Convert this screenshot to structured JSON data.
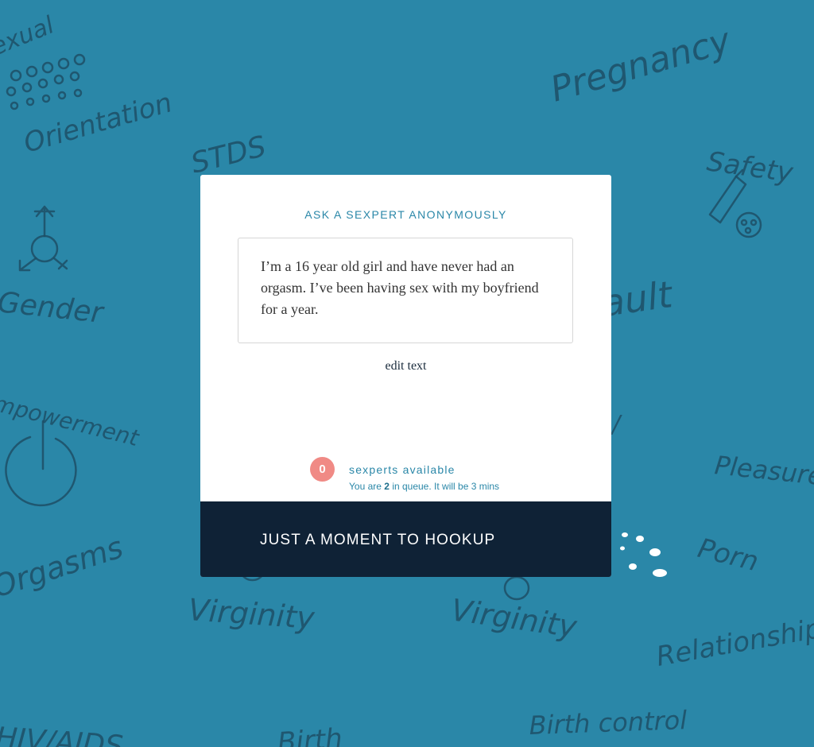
{
  "background": {
    "color": "#2a87a8",
    "words": [
      "Sexual Orientation",
      "STDS",
      "Pregnancy",
      "Safety",
      "Gender",
      "Empowerment",
      "Pleasure",
      "Orgasms",
      "Virginity",
      "Porn",
      "Relationships",
      "HIV/AIDS",
      "Birth control",
      "Assault",
      "Birth"
    ]
  },
  "card": {
    "heading": "ASK A SEXPERT ANONYMOUSLY",
    "question": "I’m a 16 year old girl and have never had an orgasm. I’ve been having sex with my boyfriend for a year.",
    "edit_label": "edit text",
    "availability": {
      "count": "0",
      "label": "sexperts available",
      "queue_prefix": "You are",
      "queue_position": "2",
      "queue_suffix": "in queue. It will be 3 mins"
    },
    "hookup_label": "JUST A MOMENT TO HOOKUP"
  },
  "colors": {
    "accent": "#2a87a8",
    "dark_bar": "#0f2236",
    "badge": "#f08a85"
  }
}
